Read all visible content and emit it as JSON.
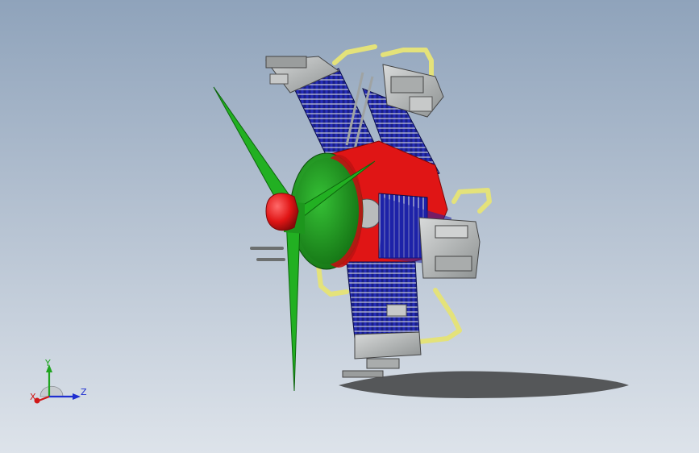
{
  "viewport": {
    "background_top": "#8fa3bb",
    "background_bottom": "#dde3ea"
  },
  "model": {
    "description_icon": "radial-engine-assembly-icon",
    "colors": {
      "propeller": "#22b022",
      "spinner": "#e01515",
      "crankcase": "#e01515",
      "cylinder": "#1d22a8",
      "cylinder_head": "#b9bcbc",
      "pipe": "#e4e27a",
      "front_cover": "#1f9a1f"
    }
  },
  "triad": {
    "x_label": "X",
    "y_label": "Y",
    "z_label": "Z",
    "x_color": "#d01818",
    "y_color": "#1fa51f",
    "z_color": "#1f2fd0"
  }
}
